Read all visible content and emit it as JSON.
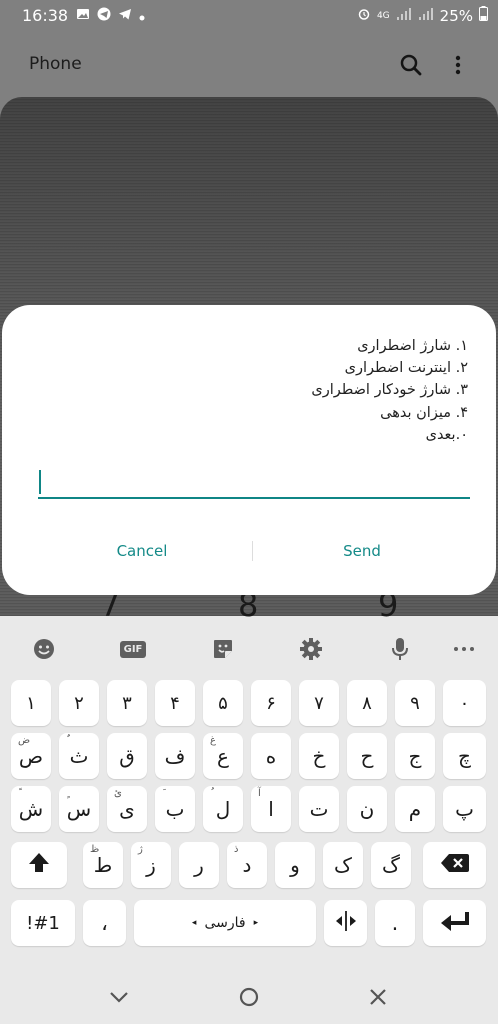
{
  "status_bar": {
    "time": "16:38",
    "network": "4G",
    "battery": "25%"
  },
  "app": {
    "title": "Phone"
  },
  "background_digits": [
    "7",
    "8",
    "9"
  ],
  "dialog": {
    "lines": [
      "۱. شارژ اضطراری",
      "۲. اینترنت اضطراری",
      "۳. شارژ خودکار اضطراری",
      "۴. میزان بدهی",
      "۰.بعدی"
    ],
    "input_value": "",
    "cancel_label": "Cancel",
    "send_label": "Send"
  },
  "keyboard": {
    "toolbar": {
      "gif_label": "GIF"
    },
    "rows": [
      [
        {
          "k": "۱"
        },
        {
          "k": "۲"
        },
        {
          "k": "۳"
        },
        {
          "k": "۴"
        },
        {
          "k": "۵"
        },
        {
          "k": "۶"
        },
        {
          "k": "۷"
        },
        {
          "k": "۸"
        },
        {
          "k": "۹"
        },
        {
          "k": "۰"
        }
      ],
      [
        {
          "k": "ص",
          "h": "ض"
        },
        {
          "k": "ث",
          "h": "ٌ"
        },
        {
          "k": "ق",
          "h": ""
        },
        {
          "k": "ف",
          "h": ""
        },
        {
          "k": "غ",
          "h": "غ"
        },
        {
          "k": "ع",
          "h": ""
        },
        {
          "k": "ه",
          "h": ""
        },
        {
          "k": "خ",
          "h": ""
        },
        {
          "k": "ح",
          "h": ""
        },
        {
          "k": "ج",
          "h": ""
        },
        {
          "k": "چ",
          "h": ""
        }
      ],
      [
        {
          "k": "ش",
          "h": "ً"
        },
        {
          "k": "س",
          "h": "ٍ"
        },
        {
          "k": "ی",
          "h": "ئ"
        },
        {
          "k": "ب",
          "h": "َ"
        },
        {
          "k": "ل",
          "h": "ُ"
        },
        {
          "k": "ا",
          "h": "آ"
        },
        {
          "k": "ت",
          "h": ""
        },
        {
          "k": "ن",
          "h": ""
        },
        {
          "k": "م",
          "h": ""
        },
        {
          "k": "پ",
          "h": ""
        }
      ],
      [
        {
          "k": "ط",
          "h": "ظ"
        },
        {
          "k": "ز",
          "h": "ژ"
        },
        {
          "k": "ر",
          "h": ""
        },
        {
          "k": "د",
          "h": "ذ"
        },
        {
          "k": "و",
          "h": ""
        },
        {
          "k": "ک",
          "h": ""
        },
        {
          "k": "گ",
          "h": ""
        }
      ],
      [
        {
          "k": "!#1"
        },
        {
          "k": "،"
        },
        {
          "k": "فارسی"
        },
        {
          "k": "."
        }
      ]
    ],
    "space_label": "فارسی",
    "symbols_label": "!#1",
    "comma_label": "،",
    "period_label": "."
  },
  "icons": {
    "status_left": [
      "gallery-icon",
      "telegram-icon",
      "telegram-icon",
      "dot-icon"
    ],
    "toolbar": [
      "emoji-icon",
      "gif-icon",
      "sticker-icon",
      "settings-icon",
      "microphone-icon",
      "more-icon"
    ],
    "nav": [
      "back-icon",
      "home-icon",
      "recents-icon"
    ]
  }
}
